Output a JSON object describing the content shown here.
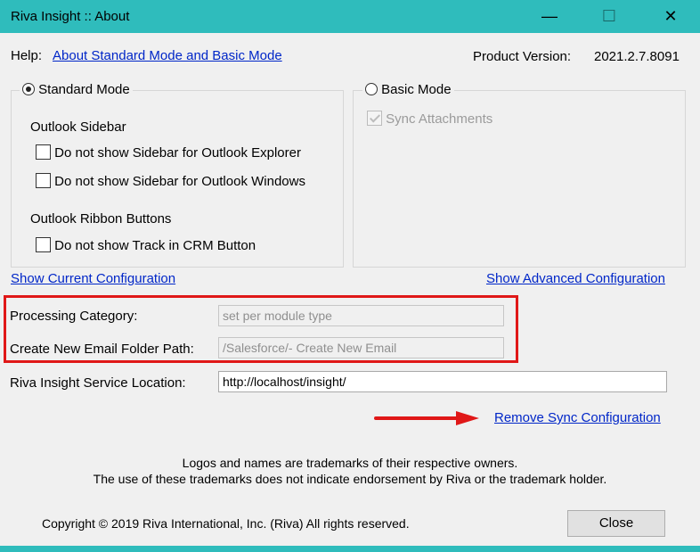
{
  "window": {
    "title": "Riva Insight :: About",
    "minimize_glyph": "—",
    "maximize_glyph": "☐",
    "close_glyph": "✕"
  },
  "help": {
    "label": "Help:",
    "link": "About Standard Mode and Basic Mode"
  },
  "product_version": {
    "label": "Product Version:",
    "value": "2021.2.7.8091"
  },
  "standard_mode": {
    "label": "Standard Mode",
    "selected": true,
    "sidebar_heading": "Outlook Sidebar",
    "sidebar_explorer": "Do not show Sidebar for Outlook Explorer",
    "sidebar_windows": "Do not show Sidebar for Outlook Windows",
    "ribbon_heading": "Outlook Ribbon Buttons",
    "track_button": "Do not show Track in CRM Button"
  },
  "basic_mode": {
    "label": "Basic Mode",
    "selected": false,
    "sync_attachments": "Sync Attachments"
  },
  "links": {
    "show_current": "Show Current Configuration",
    "show_advanced": "Show Advanced Configuration",
    "remove_sync": "Remove Sync Configuration"
  },
  "fields": {
    "processing_category_label": "Processing Category:",
    "processing_category_value": "set per module type",
    "email_folder_label": "Create New Email Folder Path:",
    "email_folder_value": "/Salesforce/- Create New Email",
    "service_location_label": "Riva Insight Service Location:",
    "service_location_value": "http://localhost/insight/"
  },
  "notice": {
    "line1": "Logos and names are trademarks of their respective owners.",
    "line2": "The use of these trademarks does not indicate endorsement by Riva or the trademark holder."
  },
  "copyright": "Copyright © 2019 Riva International, Inc. (Riva) All rights reserved.",
  "close_label": "Close",
  "colors": {
    "titlebar": "#2fbcbc",
    "link": "#0026c8",
    "highlight": "#e01818"
  }
}
